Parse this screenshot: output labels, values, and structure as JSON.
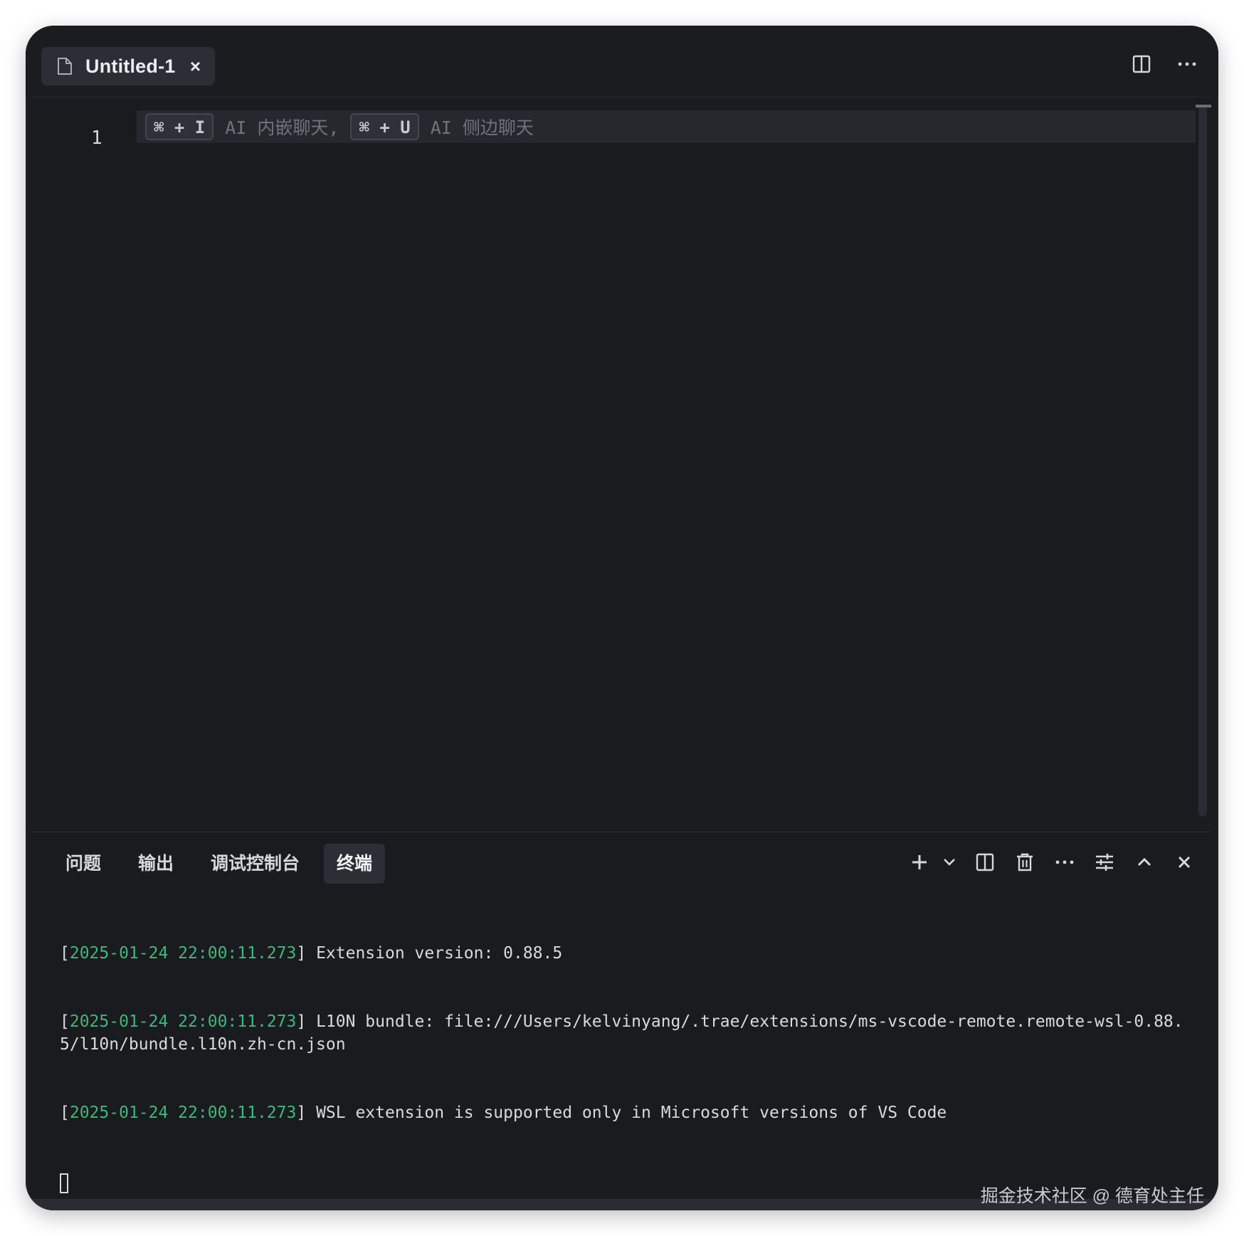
{
  "tab": {
    "label": "Untitled-1",
    "close": "×",
    "file_icon": "file-icon"
  },
  "editor": {
    "line_number": "1",
    "hint": {
      "key1": "⌘ + I",
      "text1": "AI 内嵌聊天,",
      "key2": "⌘ + U",
      "text2": "AI 侧边聊天"
    }
  },
  "panel": {
    "tabs": [
      {
        "label": "问题"
      },
      {
        "label": "输出"
      },
      {
        "label": "调试控制台"
      },
      {
        "label": "终端"
      }
    ],
    "active_tab": "终端",
    "terminal_lines": [
      {
        "timestamp": "2025-01-24 22:00:11.273",
        "message": "Extension version: 0.88.5"
      },
      {
        "timestamp": "2025-01-24 22:00:11.273",
        "message": "L10N bundle: file:///Users/kelvinyang/.trae/extensions/ms-vscode-remote.remote-wsl-0.88.5/l10n/bundle.l10n.zh-cn.json"
      },
      {
        "timestamp": "2025-01-24 22:00:11.273",
        "message": "WSL extension is supported only in Microsoft versions of VS Code"
      }
    ]
  },
  "watermark": "掘金技术社区 @ 德育处主任",
  "colors": {
    "timestamp": "#3fb87a",
    "background": "#1b1c20",
    "tab_active": "#2c2e35"
  }
}
